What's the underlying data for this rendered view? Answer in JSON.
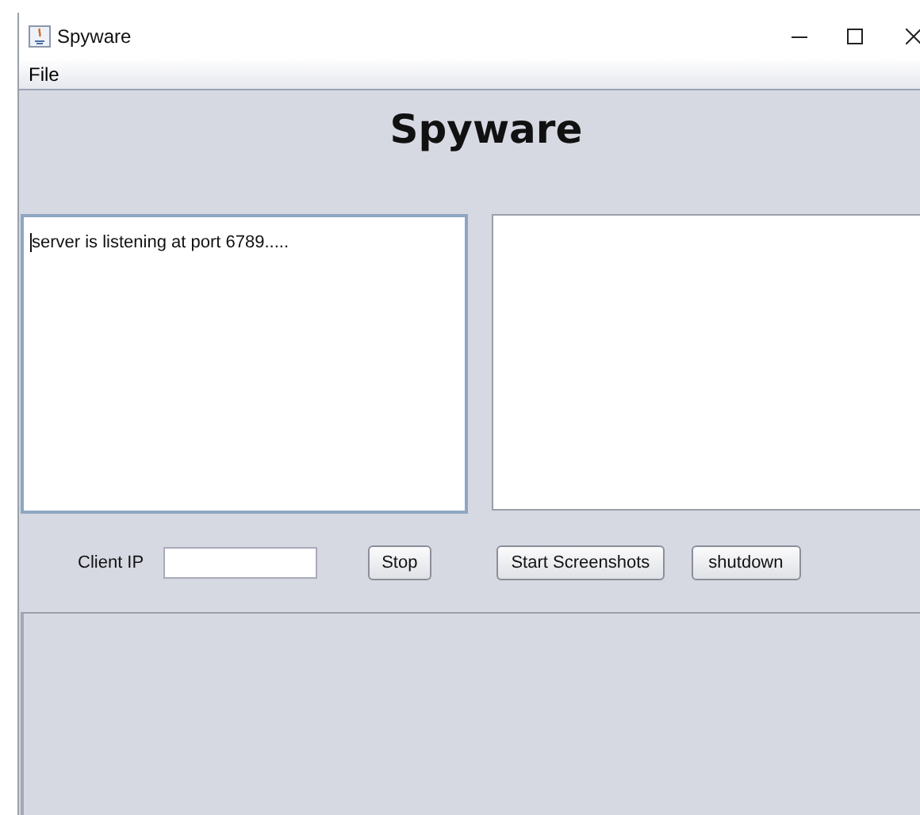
{
  "window": {
    "title": "Spyware"
  },
  "menu": [
    {
      "label": "File"
    }
  ],
  "heading": "Spyware",
  "log": {
    "text": "server is listening at port 6789....."
  },
  "controls": {
    "label": "Client IP",
    "buttons": [
      {
        "label": "Stop"
      },
      {
        "label": "Start Screenshots"
      },
      {
        "label": "shutdown"
      }
    ]
  }
}
